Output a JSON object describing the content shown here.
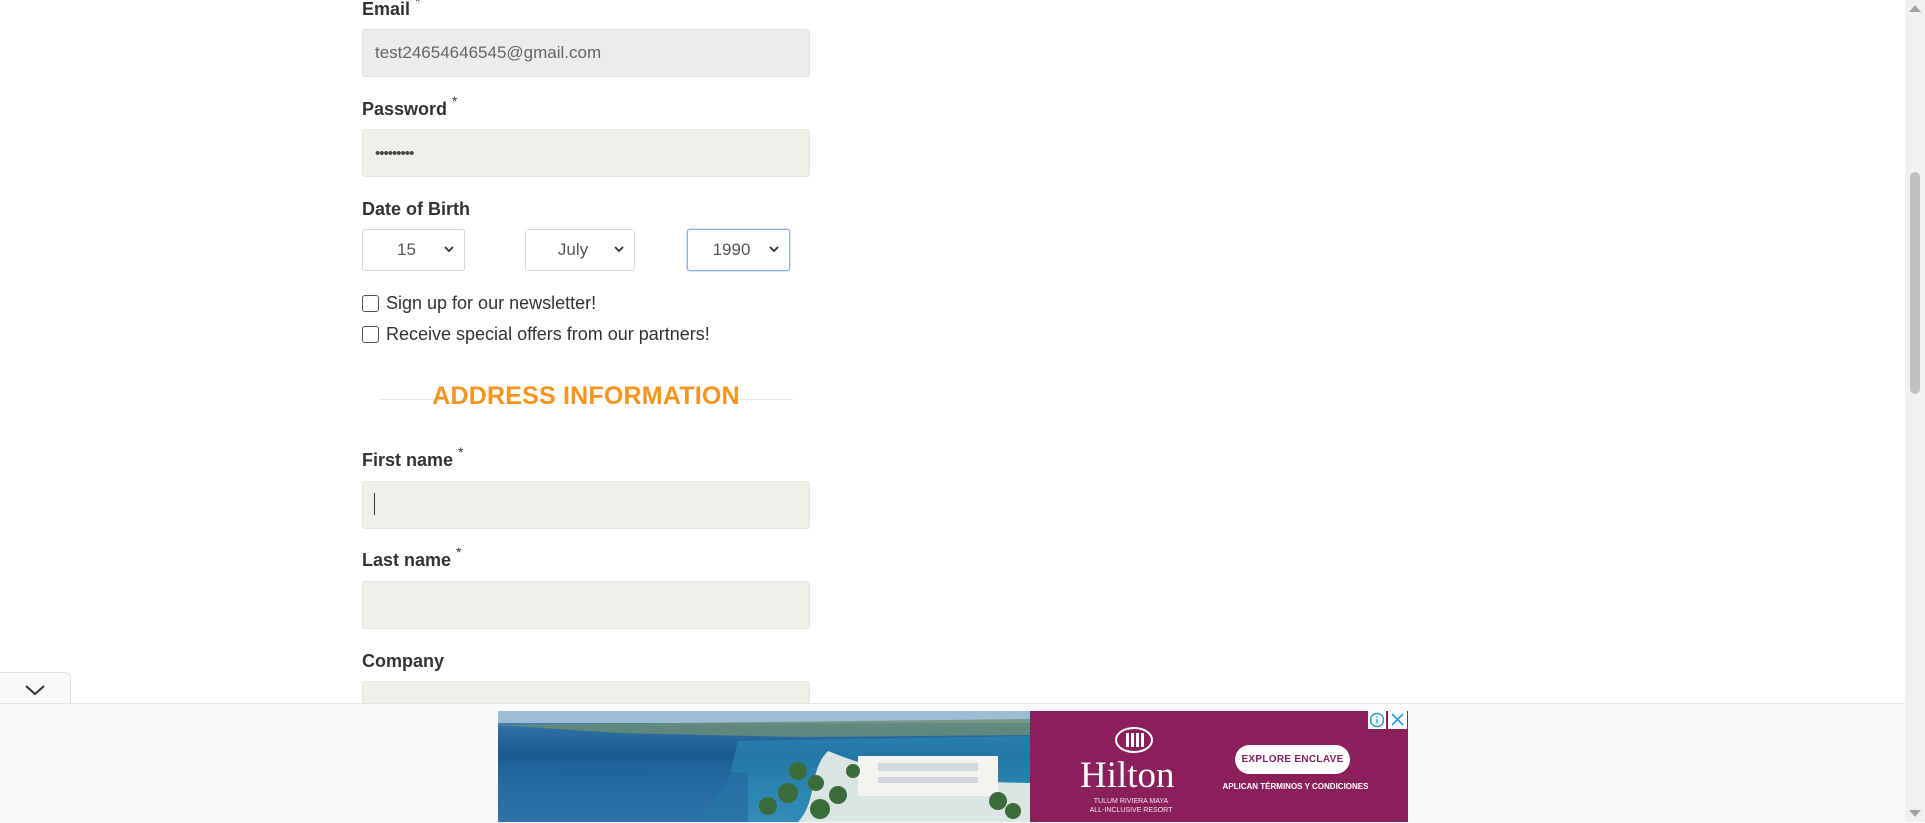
{
  "form": {
    "email": {
      "label": "Email",
      "required_mark": "*",
      "value": "test24654646545@gmail.com"
    },
    "password": {
      "label": "Password",
      "required_mark": "*",
      "masked_value": "•••••••••"
    },
    "dob": {
      "label": "Date of Birth",
      "day": "15",
      "month": "July",
      "year": "1990"
    },
    "newsletter": {
      "label": "Sign up for our newsletter!",
      "checked": false
    },
    "offers": {
      "label": "Receive special offers from our partners!",
      "checked": false
    },
    "address_section_title": "ADDRESS INFORMATION",
    "first_name": {
      "label": "First name",
      "required_mark": "*",
      "value": ""
    },
    "last_name": {
      "label": "Last name",
      "required_mark": "*",
      "value": ""
    },
    "company": {
      "label": "Company",
      "value": ""
    }
  },
  "ad": {
    "brand": "Hilton",
    "brand_sub": "TULUM RIVIERA MAYA ALL-INCLUSIVE RESORT",
    "cta": "EXPLORE ENCLAVE",
    "terms": "APLICAN TÉRMINOS Y CONDICIONES"
  },
  "colors": {
    "section_title": "#f7941d",
    "ad_panel": "#8a1f5c",
    "input_bg": "#f0f0eb"
  },
  "icons": {
    "collapse": "chevron-down-icon",
    "ad_info": "info-icon",
    "ad_close": "close-icon"
  }
}
